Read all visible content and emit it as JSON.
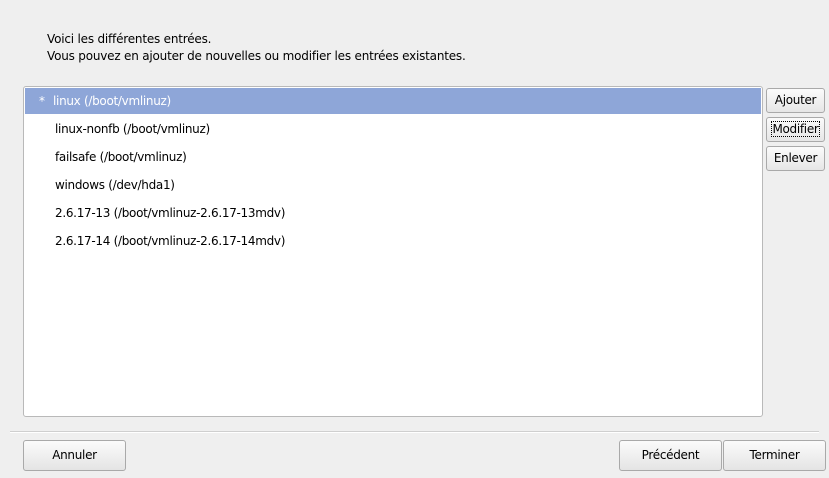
{
  "intro": {
    "line1": "Voici les différentes entrées.",
    "line2": "Vous pouvez en ajouter de nouvelles ou modifier les entrées existantes."
  },
  "entries": [
    {
      "mark": "*",
      "label": "linux (/boot/vmlinuz)",
      "selected": true
    },
    {
      "mark": "",
      "label": "linux-nonfb (/boot/vmlinuz)",
      "selected": false
    },
    {
      "mark": "",
      "label": "failsafe (/boot/vmlinuz)",
      "selected": false
    },
    {
      "mark": "",
      "label": "windows (/dev/hda1)",
      "selected": false
    },
    {
      "mark": "",
      "label": "2.6.17-13 (/boot/vmlinuz-2.6.17-13mdv)",
      "selected": false
    },
    {
      "mark": "",
      "label": "2.6.17-14 (/boot/vmlinuz-2.6.17-14mdv)",
      "selected": false
    }
  ],
  "actions": {
    "add": "Ajouter",
    "modify": "Modifier",
    "remove": "Enlever"
  },
  "footer": {
    "cancel": "Annuler",
    "previous": "Précédent",
    "finish": "Terminer"
  },
  "colors": {
    "selection": "#8ea6d8",
    "window_bg": "#efefef"
  }
}
